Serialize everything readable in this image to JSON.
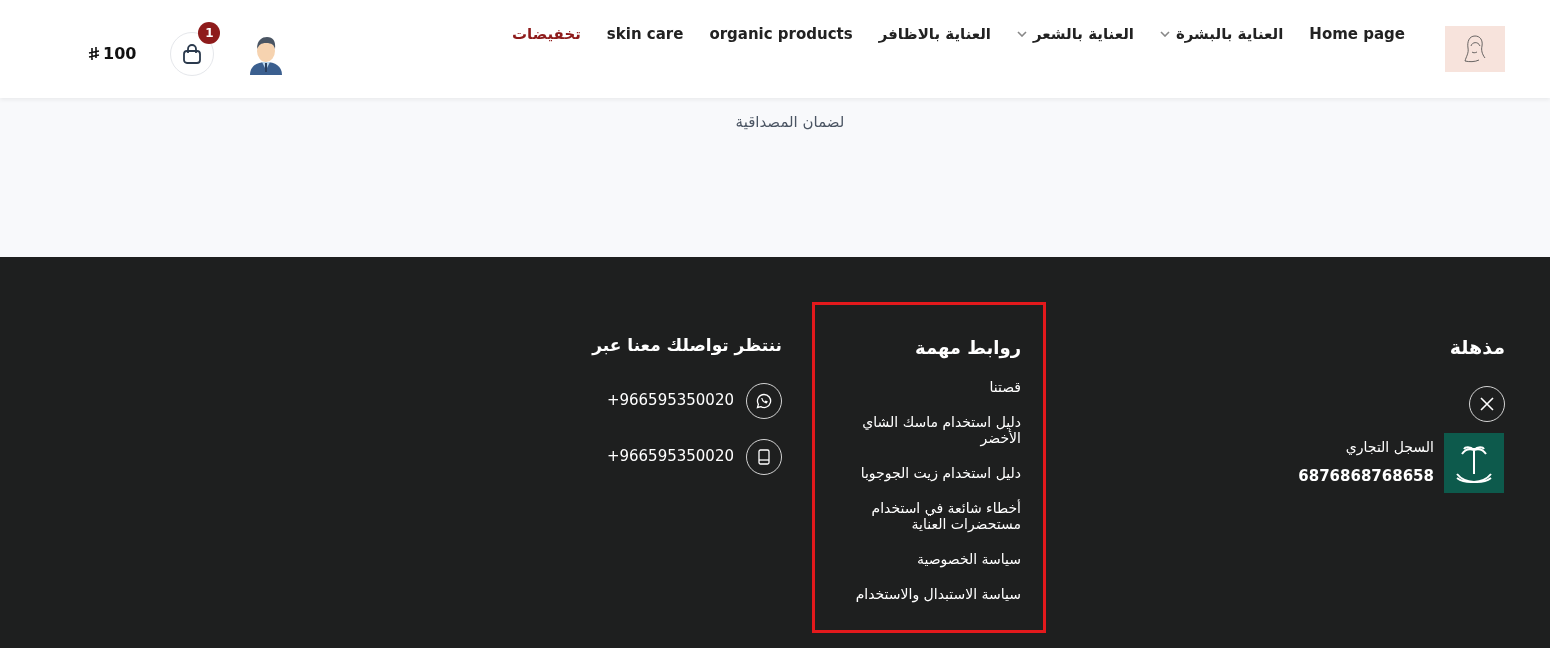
{
  "header": {
    "nav": [
      {
        "label": "Home page",
        "has_dropdown": false,
        "selected": false
      },
      {
        "label": "العناية بالبشرة",
        "has_dropdown": true,
        "selected": false
      },
      {
        "label": "العناية بالشعر",
        "has_dropdown": true,
        "selected": false
      },
      {
        "label": "العناية بالاظافر",
        "has_dropdown": false,
        "selected": false
      },
      {
        "label": "organic products",
        "has_dropdown": false,
        "selected": false
      },
      {
        "label": "skin care",
        "has_dropdown": false,
        "selected": false
      },
      {
        "label": "تخفيضات",
        "has_dropdown": false,
        "selected": true
      }
    ],
    "cart": {
      "count": "1",
      "total": "100"
    }
  },
  "intro": {
    "text": "لضمان المصداقية"
  },
  "footer": {
    "brand": {
      "title": "مذهلة",
      "registry_label": "السجل التجاري",
      "registry_number": "6876868768658"
    },
    "links": {
      "title": "روابط مهمة",
      "highlighted": true,
      "items": [
        "قصتنا",
        "دليل استخدام ماسك الشاي الأخضر",
        "دليل استخدام زيت الجوجوبا",
        "أخطاء شائعة في استخدام مستحضرات العناية",
        "سياسة الخصوصية",
        "سياسة الاستبدال والاستخدام"
      ]
    },
    "contact": {
      "title": "ننتظر تواصلك معنا عبر",
      "items": [
        {
          "kind": "whatsapp",
          "text": "+966595350020"
        },
        {
          "kind": "phone",
          "text": "+966595350020"
        }
      ]
    }
  }
}
